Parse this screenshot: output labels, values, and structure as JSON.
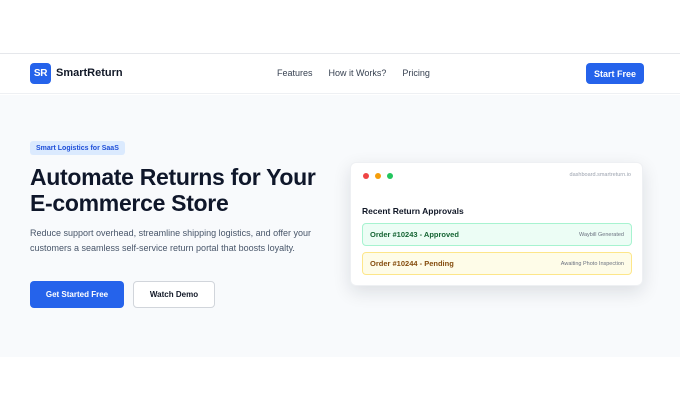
{
  "brand": {
    "logo_initials": "SR",
    "name": "SmartReturn",
    "accent_color": "#2563eb"
  },
  "nav": {
    "links": [
      "Features",
      "How it Works?",
      "Pricing"
    ],
    "cta_label": "Start Free"
  },
  "hero": {
    "badge": "Smart Logistics for SaaS",
    "headline": "Automate Returns for Your E-commerce Store",
    "subheadline": "Reduce support overhead, streamline shipping logistics, and offer your customers a seamless self-service return portal that boosts loyalty.",
    "primary_cta": "Get Started Free",
    "secondary_cta": "Watch Demo"
  },
  "preview_card": {
    "url": "dashboard.smartreturn.io",
    "title": "Recent Return Approvals",
    "rows": [
      {
        "title": "Order #10243 - Approved",
        "status": "Waybill Generated",
        "color": "#16a34a"
      },
      {
        "title": "Order #10244 - Pending",
        "status": "Awaiting Photo Inspection",
        "color": "#ca8a04"
      }
    ]
  }
}
